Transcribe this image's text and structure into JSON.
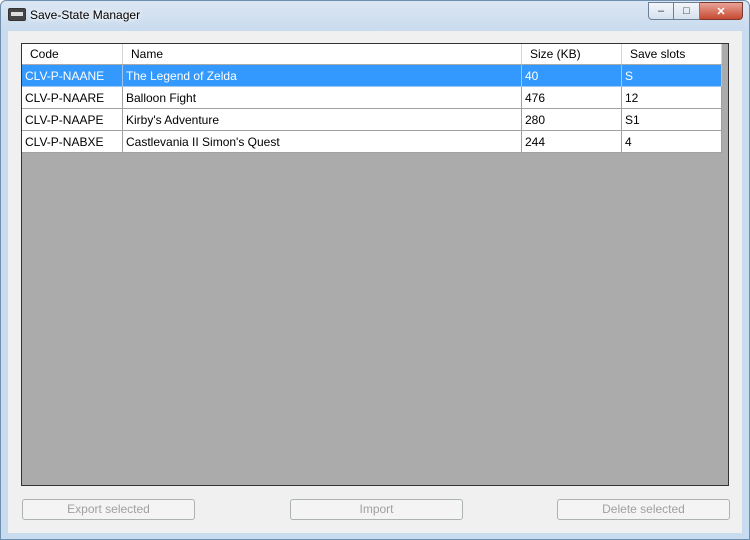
{
  "window": {
    "title": "Save-State Manager"
  },
  "caption": {
    "minimize": "–",
    "maximize": "□",
    "close": "✕"
  },
  "table": {
    "columns": [
      "Code",
      "Name",
      "Size (KB)",
      "Save slots"
    ],
    "rows": [
      {
        "code": "CLV-P-NAANE",
        "name": "The Legend of Zelda",
        "size": "40",
        "slots": "S",
        "selected": true
      },
      {
        "code": "CLV-P-NAARE",
        "name": "Balloon Fight",
        "size": "476",
        "slots": "12",
        "selected": false
      },
      {
        "code": "CLV-P-NAAPE",
        "name": "Kirby's Adventure",
        "size": "280",
        "slots": "S1",
        "selected": false
      },
      {
        "code": "CLV-P-NABXE",
        "name": "Castlevania II Simon's Quest",
        "size": "244",
        "slots": "4",
        "selected": false
      }
    ]
  },
  "buttons": {
    "export": "Export selected",
    "import": "Import",
    "delete": "Delete selected"
  },
  "colors": {
    "selection": "#3399ff",
    "grid_background": "#ababab"
  }
}
